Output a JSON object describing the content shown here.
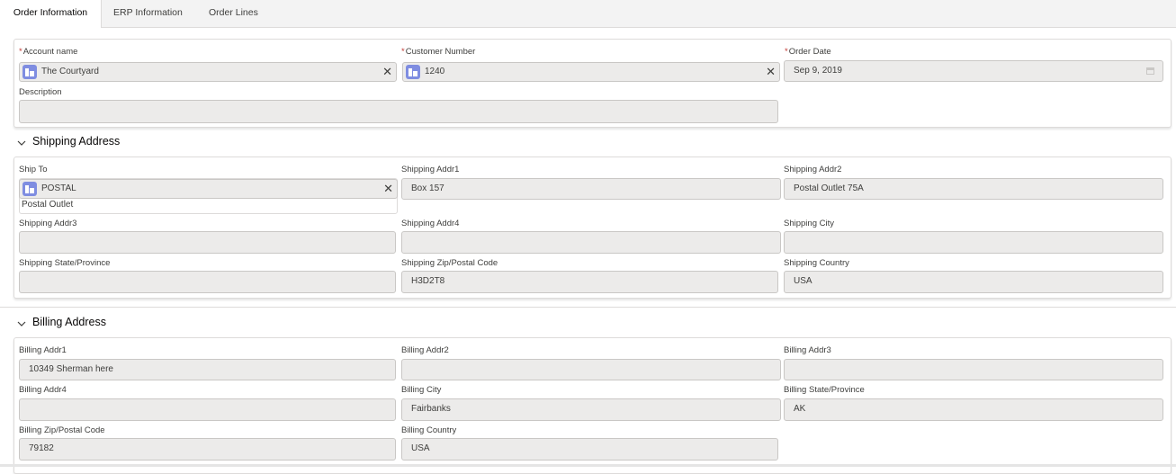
{
  "tabs": [
    {
      "label": "Order Information"
    },
    {
      "label": "ERP Information"
    },
    {
      "label": "Order Lines"
    }
  ],
  "order": {
    "account_label": "Account name",
    "account_value": "The Courtyard",
    "customer_label": "Customer Number",
    "customer_value": "1240",
    "date_label": "Order Date",
    "date_value": "Sep 9, 2019",
    "description_label": "Description",
    "description_value": "",
    "required_marker": "*"
  },
  "shipping": {
    "title": "Shipping Address",
    "ship_to_label": "Ship To",
    "ship_to_value": "POSTAL",
    "ship_to_sub": "Postal Outlet",
    "addr1_label": "Shipping Addr1",
    "addr1_value": "Box 157",
    "addr2_label": "Shipping Addr2",
    "addr2_value": "Postal Outlet 75A",
    "addr3_label": "Shipping Addr3",
    "addr3_value": "",
    "addr4_label": "Shipping Addr4",
    "addr4_value": "",
    "city_label": "Shipping City",
    "city_value": "",
    "state_label": "Shipping State/Province",
    "state_value": "",
    "zip_label": "Shipping Zip/Postal Code",
    "zip_value": "H3D2T8",
    "country_label": "Shipping Country",
    "country_value": "USA"
  },
  "billing": {
    "title": "Billing Address",
    "addr1_label": "Billing Addr1",
    "addr1_value": "10349 Sherman here",
    "addr2_label": "Billing Addr2",
    "addr2_value": "",
    "addr3_label": "Billing Addr3",
    "addr3_value": "",
    "addr4_label": "Billing Addr4",
    "addr4_value": "",
    "city_label": "Billing City",
    "city_value": "Fairbanks",
    "state_label": "Billing State/Province",
    "state_value": "AK",
    "zip_label": "Billing Zip/Postal Code",
    "zip_value": "79182",
    "country_label": "Billing Country",
    "country_value": "USA"
  },
  "icons": {
    "lookup_icon_color": "#7f8de1",
    "required_color": "#c23934"
  }
}
